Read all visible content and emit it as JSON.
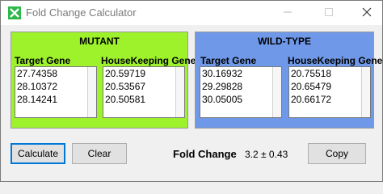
{
  "window": {
    "title": "Fold Change Calculator"
  },
  "mutant": {
    "title": "MUTANT",
    "target_label": "Target Gene",
    "house_label": "HouseKeeping Gene",
    "target_values": [
      "27.74358",
      "28.10372",
      "28.14241"
    ],
    "house_values": [
      "20.59719",
      "20.53567",
      "20.50581"
    ]
  },
  "wild": {
    "title": "WILD-TYPE",
    "target_label": "Target Gene",
    "house_label": "HouseKeeping Gene",
    "target_values": [
      "30.16932",
      "29.29828",
      "30.05005"
    ],
    "house_values": [
      "20.75518",
      "20.65479",
      "20.66172"
    ]
  },
  "buttons": {
    "calculate": "Calculate",
    "clear": "Clear",
    "copy": "Copy"
  },
  "result": {
    "label": "Fold Change",
    "value": "3.2 ± 0.43"
  },
  "colors": {
    "mutant_panel": "#9ef22c",
    "wild_panel": "#6f98e8",
    "focus_border": "#0078d7"
  },
  "icons": {
    "app": "fold-change-app-icon",
    "minimize": "minimize-icon",
    "maximize": "maximize-icon",
    "close": "close-icon"
  }
}
